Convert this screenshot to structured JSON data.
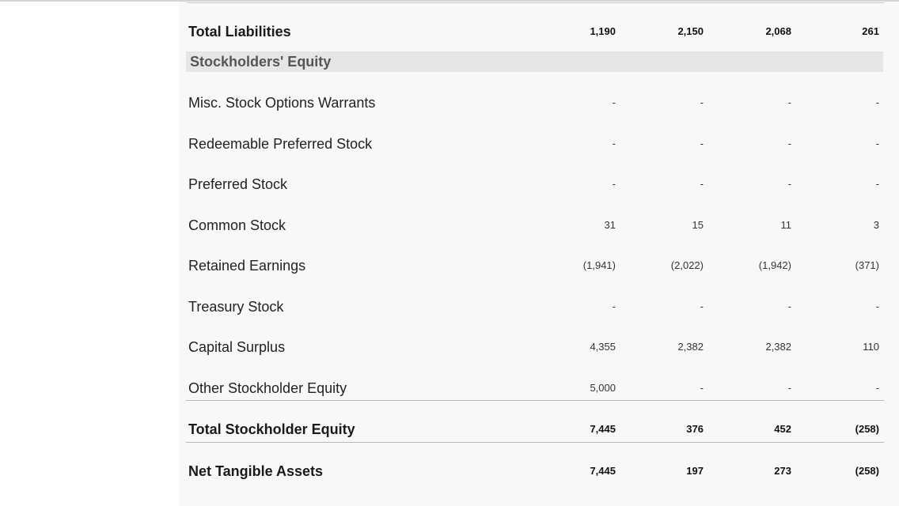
{
  "rows_top": {
    "total_liabilities": {
      "label": "Total Liabilities",
      "values": [
        "1,190",
        "2,150",
        "2,068",
        "261"
      ]
    }
  },
  "section_header": "Stockholders' Equity",
  "equity_rows": [
    {
      "label": "Misc. Stock Options Warrants",
      "values": [
        "-",
        "-",
        "-",
        "-"
      ]
    },
    {
      "label": "Redeemable Preferred Stock",
      "values": [
        "-",
        "-",
        "-",
        "-"
      ]
    },
    {
      "label": "Preferred Stock",
      "values": [
        "-",
        "-",
        "-",
        "-"
      ]
    },
    {
      "label": "Common Stock",
      "values": [
        "31",
        "15",
        "11",
        "3"
      ]
    },
    {
      "label": "Retained Earnings",
      "values": [
        "(1,941)",
        "(2,022)",
        "(1,942)",
        "(371)"
      ]
    },
    {
      "label": "Treasury Stock",
      "values": [
        "-",
        "-",
        "-",
        "-"
      ]
    },
    {
      "label": "Capital Surplus",
      "values": [
        "4,355",
        "2,382",
        "2,382",
        "110"
      ]
    },
    {
      "label": "Other Stockholder Equity",
      "values": [
        "5,000",
        "-",
        "-",
        "-"
      ]
    }
  ],
  "totals": {
    "total_stockholder_equity": {
      "label": "Total Stockholder Equity",
      "values": [
        "7,445",
        "376",
        "452",
        "(258)"
      ]
    },
    "net_tangible_assets": {
      "label": "Net Tangible Assets",
      "values": [
        "7,445",
        "197",
        "273",
        "(258)"
      ]
    }
  }
}
